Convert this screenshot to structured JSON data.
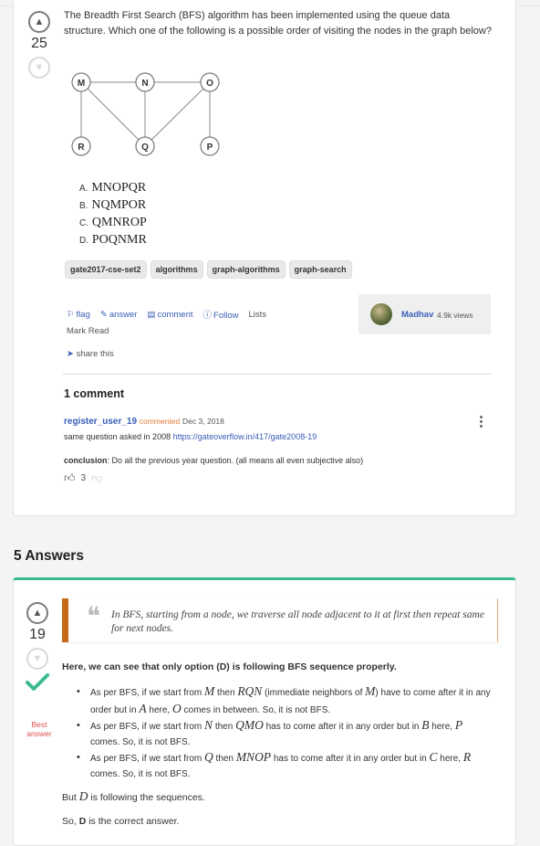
{
  "question": {
    "votes": "25",
    "text": "The Breadth First Search (BFS) algorithm has been implemented using the queue data structure. Which one of the following is a possible order of visiting the nodes in the graph below?",
    "graph_nodes": [
      "M",
      "N",
      "O",
      "R",
      "Q",
      "P"
    ],
    "options": [
      {
        "letter": "A.",
        "value": "MNOPQR"
      },
      {
        "letter": "B.",
        "value": "NQMPOR"
      },
      {
        "letter": "C.",
        "value": "QMNROP"
      },
      {
        "letter": "D.",
        "value": "POQNMR"
      }
    ],
    "tags": [
      "gate2017-cse-set2",
      "algorithms",
      "graph-algorithms",
      "graph-search"
    ],
    "actions": {
      "flag": "flag",
      "answer": "answer",
      "comment": "comment",
      "follow": "Follow",
      "lists": "Lists"
    },
    "mark_read": "Mark Read",
    "share": "share this",
    "author": {
      "name": "Madhav",
      "views": "4.9k views"
    }
  },
  "comments": {
    "heading": "1 comment",
    "items": [
      {
        "user": "register_user_19",
        "verb": "commented",
        "date": "Dec 3, 2018",
        "line1_prefix": "same question asked in 2008 ",
        "link": "https://gateoverflow.in/417/gate2008-19",
        "conclusion_label": "conclusion",
        "conclusion_text": ": Do all the previous year question. (all means all even subjective also)",
        "upvotes": "3"
      }
    ]
  },
  "answers": {
    "heading": "5 Answers",
    "first": {
      "votes": "19",
      "best_label": "Best answer",
      "quote": "In BFS, starting from a node, we traverse all node adjacent to it at first then repeat same for next nodes.",
      "lead": "Here, we can see that only option (D) is following BFS sequence properly.",
      "bullets": [
        {
          "a": "As per BFS, if we start from ",
          "m1": "M",
          "b": " then ",
          "m2": "RQN",
          "c": " (immediate neighbors of ",
          "m3": "M",
          "d": ") have to come after it in any order but in ",
          "m4": "A",
          "e": " here, ",
          "m5": "O",
          "f": " comes in between. So, it is not BFS."
        },
        {
          "a": "As per BFS, if we start from ",
          "m1": "N",
          "b": " then ",
          "m2": "QMO",
          "c": " has to come after it in any order but in ",
          "m3": "B",
          "d": " here, ",
          "m4": "P",
          "e": " comes. So, it is not BFS.",
          "m5": "",
          "f": ""
        },
        {
          "a": "As per BFS, if we start from ",
          "m1": "Q",
          "b": " then ",
          "m2": "MNOP",
          "c": " has to come after it in any order but in ",
          "m3": "C",
          "d": " here, ",
          "m4": "R",
          "e": " comes. So, it is not BFS.",
          "m5": "",
          "f": ""
        }
      ],
      "tail1_a": "But ",
      "tail1_m": "D",
      "tail1_b": " is following the sequences.",
      "tail2_a": "So, ",
      "tail2_b": "D",
      "tail2_c": " is the correct answer."
    }
  }
}
